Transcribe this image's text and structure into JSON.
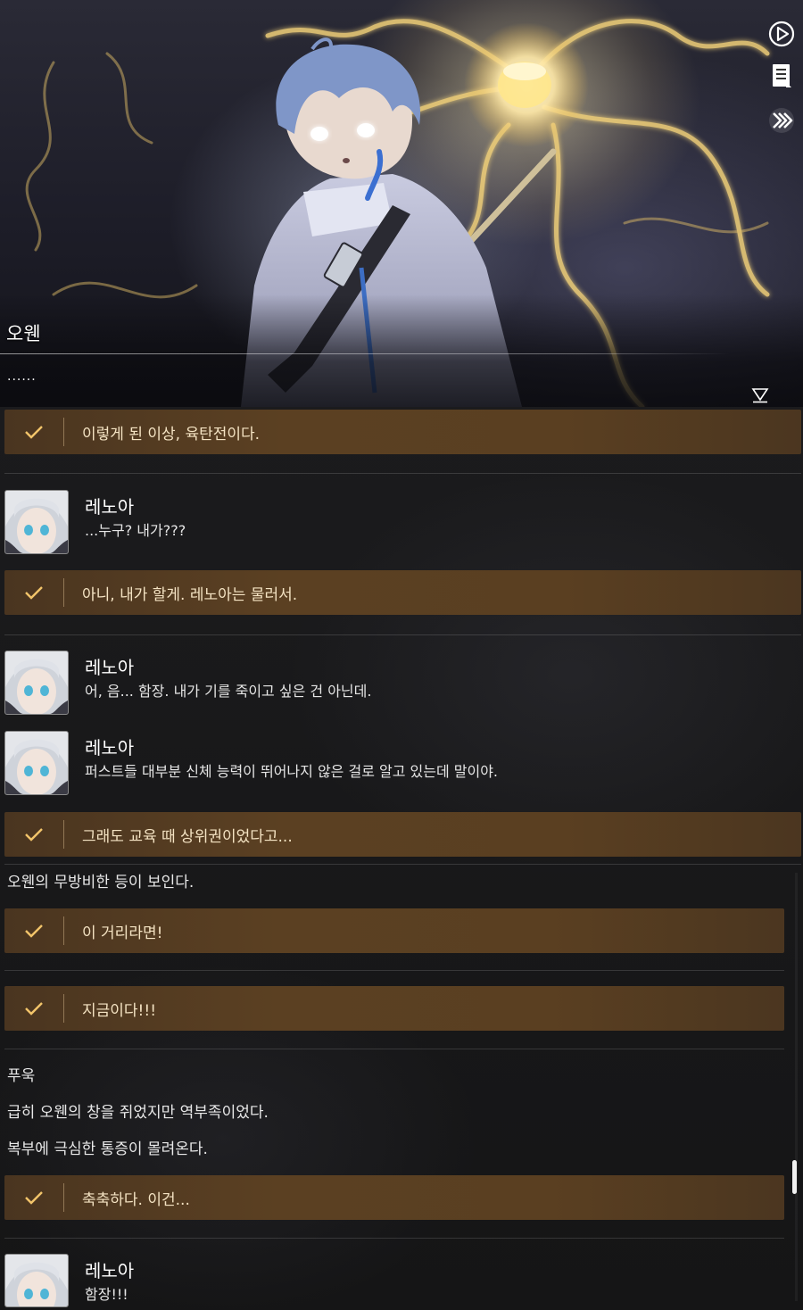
{
  "scene": {
    "speaker_name": "오웬",
    "speaker_line": "......",
    "controls": {
      "auto_play_icon": "play-circle-icon",
      "log_icon": "log-document-icon",
      "skip_icon": "fast-forward-icon"
    }
  },
  "log": {
    "choice1": "이렇게 된 이상, 육탄전이다.",
    "dialog1": {
      "name": "레노아",
      "text": "...누구? 내가???"
    },
    "choice2": "아니, 내가 할게. 레노아는 물러서.",
    "dialog2": {
      "name": "레노아",
      "text": "어, 음... 함장. 내가 기를 죽이고 싶은 건 아닌데."
    },
    "dialog3": {
      "name": "레노아",
      "text": "퍼스트들 대부분 신체 능력이 뛰어나지 않은 걸로 알고 있는데 말이야."
    },
    "choice3": "그래도 교육 때 상위권이었다고...",
    "narration1": "오웬의 무방비한 등이 보인다.",
    "choice4": "이 거리라면!",
    "choice5": "지금이다!!!",
    "narration2": "푸욱",
    "narration3": "급히 오웬의 창을 쥐었지만 역부족이었다.",
    "narration4": "복부에 극심한 통증이 몰려온다.",
    "choice6": "축축하다. 이건...",
    "dialog4": {
      "name": "레노아",
      "text": "함장!!!"
    }
  },
  "colors": {
    "choice_bg": "#5b4022",
    "choice_text": "#f4e3c3",
    "check_color": "#f2c46a",
    "log_bg": "#151516"
  }
}
